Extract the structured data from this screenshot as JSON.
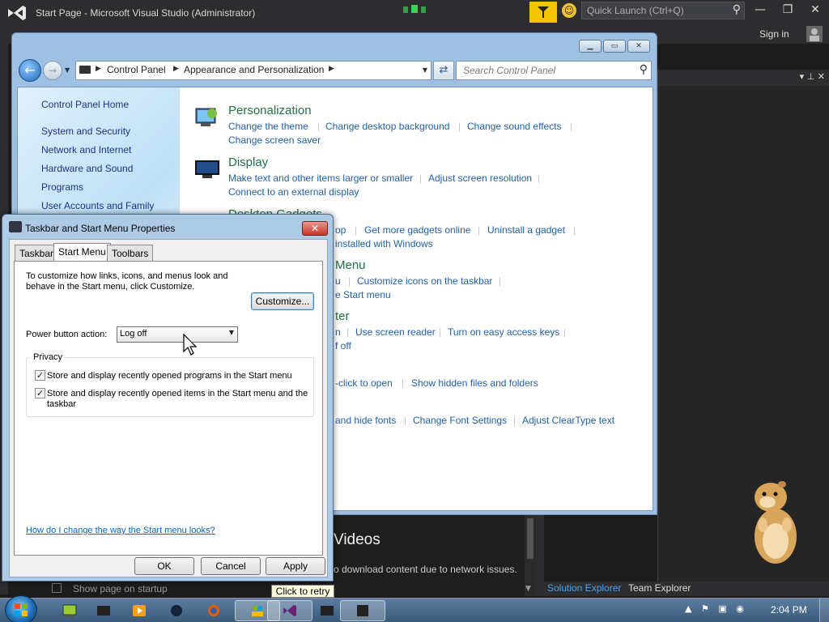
{
  "vs": {
    "title": "Start Page - Microsoft Visual Studio (Administrator)",
    "quick_launch_placeholder": "Quick Launch (Ctrl+Q)",
    "sign_in": "Sign in",
    "videos_heading": "Videos",
    "network_msg": "o download content due to network issues.",
    "show_startup": "Show page on startup",
    "solution_explorer": "Solution Explorer",
    "team_explorer": "Team Explorer",
    "tooltip": "Click to retry",
    "colors": {
      "chrome": "#2d2d30",
      "accent": "#68217a"
    }
  },
  "cp": {
    "breadcrumb": [
      "Control Panel",
      "Appearance and Personalization"
    ],
    "search_placeholder": "Search Control Panel",
    "sidebar": [
      "Control Panel Home",
      "System and Security",
      "Network and Internet",
      "Hardware and Sound",
      "Programs",
      "User Accounts and Family"
    ],
    "categories": {
      "personalization": {
        "title": "Personalization",
        "links": [
          "Change the theme",
          "Change desktop background",
          "Change sound effects",
          "Change screen saver"
        ]
      },
      "display": {
        "title": "Display",
        "links": [
          "Make text and other items larger or smaller",
          "Adjust screen resolution",
          "Connect to an external display"
        ]
      },
      "gadgets": {
        "title": "Desktop Gadgets",
        "links": [
          "op",
          "Get more gadgets online",
          "Uninstall a gadget",
          "installed with Windows"
        ]
      },
      "taskbar": {
        "title": "Menu",
        "links": [
          "u",
          "Customize icons on the taskbar",
          "e Start menu"
        ]
      },
      "ease": {
        "title": "ter",
        "links": [
          "n",
          "Use screen reader",
          "Turn on easy access keys",
          "f off"
        ]
      },
      "folder": {
        "links": [
          "-click to open",
          "Show hidden files and folders"
        ]
      },
      "fonts": {
        "links": [
          "and hide fonts",
          "Change Font Settings",
          "Adjust ClearType text"
        ]
      }
    }
  },
  "dialog": {
    "title": "Taskbar and Start Menu Properties",
    "tabs": [
      "Taskbar",
      "Start Menu",
      "Toolbars"
    ],
    "selected_tab": "Start Menu",
    "description": "To customize how links, icons, and menus look and behave in the Start menu, click Customize.",
    "customize": "Customize...",
    "power_label": "Power button action:",
    "power_value": "Log off",
    "privacy_label": "Privacy",
    "check1": "Store and display recently opened programs in the Start menu",
    "check1_checked": true,
    "check2": "Store and display recently opened items in the Start menu and the taskbar",
    "check2_checked": true,
    "help_link": "How do I change the way the Start menu looks?",
    "ok": "OK",
    "cancel": "Cancel",
    "apply": "Apply",
    "close_glyph": "✕"
  },
  "taskbar": {
    "clock": "2:04 PM"
  }
}
